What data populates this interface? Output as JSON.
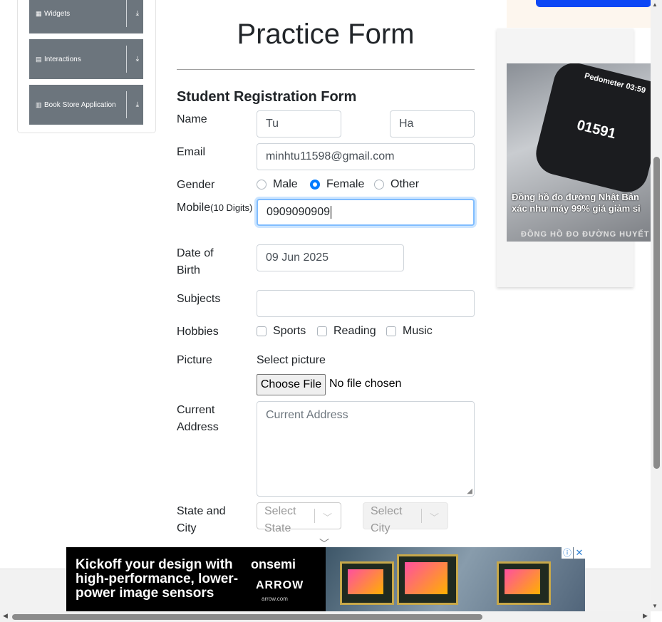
{
  "sidebar": {
    "items": [
      {
        "label": "Widgets",
        "icon": "grid-icon"
      },
      {
        "label": "Interactions",
        "icon": "square-icon"
      },
      {
        "label": "Book Store Application",
        "icon": "books-icon"
      }
    ]
  },
  "page": {
    "title": "Practice Form",
    "form_heading": "Student Registration Form"
  },
  "form": {
    "name_label": "Name",
    "first_name": "Tu",
    "last_name": "Ha",
    "email_label": "Email",
    "email": "minhtu11598@gmail.com",
    "gender_label": "Gender",
    "gender_options": [
      "Male",
      "Female",
      "Other"
    ],
    "gender_selected": "Female",
    "mobile_label": "Mobile",
    "mobile_hint": "(10 Digits)",
    "mobile": "0909090909",
    "dob_label_1": "Date of",
    "dob_label_2": "Birth",
    "dob": "09 Jun 2025",
    "subjects_label": "Subjects",
    "subjects": "",
    "hobbies_label": "Hobbies",
    "hobbies": [
      "Sports",
      "Reading",
      "Music"
    ],
    "picture_label": "Picture",
    "picture_select_text": "Select picture",
    "choose_file_label": "Choose File",
    "no_file_text": "No file chosen",
    "address_label_1": "Current",
    "address_label_2": "Address",
    "address_placeholder": "Current Address",
    "state_city_label_1": "State and",
    "state_city_label_2": "City",
    "state_placeholder": "Select State",
    "city_placeholder": "Select City"
  },
  "ads": {
    "right_caption": "Đồng hồ đo đường Nhật Bản xác như máy 99% giá giảm si",
    "right_footer": "ĐỒNG HỒ ĐO ĐƯỜNG HUYẾT",
    "right_watch_label": "Pedometer",
    "right_watch_time": "03:59",
    "right_watch_value": "01591",
    "bottom_copy": "Kickoff your design with high-performance, lower-power image sensors",
    "bottom_brand_1": "onsemi",
    "bottom_brand_2": "ARROW",
    "bottom_brand_3": "arrow.com",
    "close_symbol": "✕",
    "info_symbol": "ⓘ"
  },
  "colors": {
    "sidebar_button": "#6c757d",
    "accent": "#007bff",
    "focus_border": "#80bdff"
  }
}
